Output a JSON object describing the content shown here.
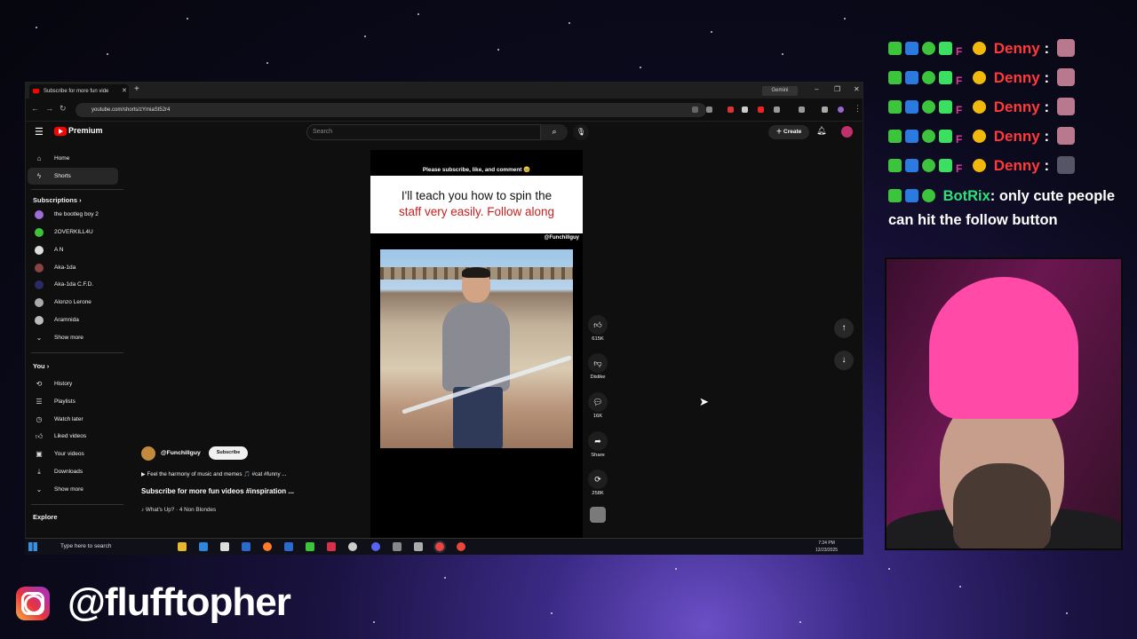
{
  "browser": {
    "tab_title": "Subscribe for more fun vide",
    "url": "youtube.com/shorts/zYmiaSt52r4",
    "gemini_label": "Gemini"
  },
  "youtube": {
    "logo_text": "Premium",
    "search_placeholder": "Search",
    "create_label": "Create"
  },
  "sidebar": {
    "main": [
      {
        "label": "Home",
        "icon": "home-icon"
      },
      {
        "label": "Shorts",
        "icon": "shorts-icon"
      }
    ],
    "subscriptions_heading": "Subscriptions",
    "subscriptions": [
      {
        "label": "the bootleg boy 2",
        "color": "#a06bd6"
      },
      {
        "label": "2OVERKILL4U",
        "color": "#3cc43c"
      },
      {
        "label": "A N",
        "color": "#dddddd"
      },
      {
        "label": "Aka-1da",
        "color": "#8a4242"
      },
      {
        "label": "Aka-1da C.F.D.",
        "color": "#2a2a66"
      },
      {
        "label": "Alonzo Lerone",
        "color": "#aaaaaa"
      },
      {
        "label": "Aramnida",
        "color": "#bbbbbb"
      }
    ],
    "show_more": "Show more",
    "you_heading": "You",
    "you_items": [
      {
        "label": "History",
        "icon": "history-icon"
      },
      {
        "label": "Playlists",
        "icon": "playlists-icon"
      },
      {
        "label": "Watch later",
        "icon": "watch-later-icon"
      },
      {
        "label": "Liked videos",
        "icon": "liked-icon"
      },
      {
        "label": "Your videos",
        "icon": "your-videos-icon"
      },
      {
        "label": "Downloads",
        "icon": "downloads-icon"
      }
    ],
    "show_more_2": "Show more",
    "explore_heading": "Explore"
  },
  "short": {
    "channel": "@Funchillguy",
    "subscribe_label": "Subscribe",
    "description": "▶ Feel the harmony of music and memes 🎵 #cat #funny ...",
    "title": "Subscribe for more fun videos #inspiration ...",
    "music": "♪ What's Up? · 4 Non Blondes",
    "video_top_text": "Please subscribe, like, and comment 🥺",
    "caption_line1": "I'll teach you how to spin the",
    "caption_line2": "staff very easily. Follow along",
    "video_handle": "@Funchillguy",
    "progress": 0.73
  },
  "actions": {
    "likes": "615K",
    "dislike": "Dislike",
    "comments": "16K",
    "share": "Share",
    "remix": "258K"
  },
  "taskbar": {
    "search_placeholder": "Type here to search",
    "time": "7:24 PM",
    "date": "12/23/2025"
  },
  "chat": {
    "messages": [
      {
        "user": "Denny",
        "sep": ":"
      },
      {
        "user": "Denny",
        "sep": ":"
      },
      {
        "user": "Denny",
        "sep": ":"
      },
      {
        "user": "Denny",
        "sep": ":"
      },
      {
        "user": "Denny",
        "sep": ":"
      }
    ],
    "bot_user": "BotRix",
    "bot_message": ": only cute people can hit the follow button"
  },
  "social": {
    "handle": "@flufftopher"
  }
}
